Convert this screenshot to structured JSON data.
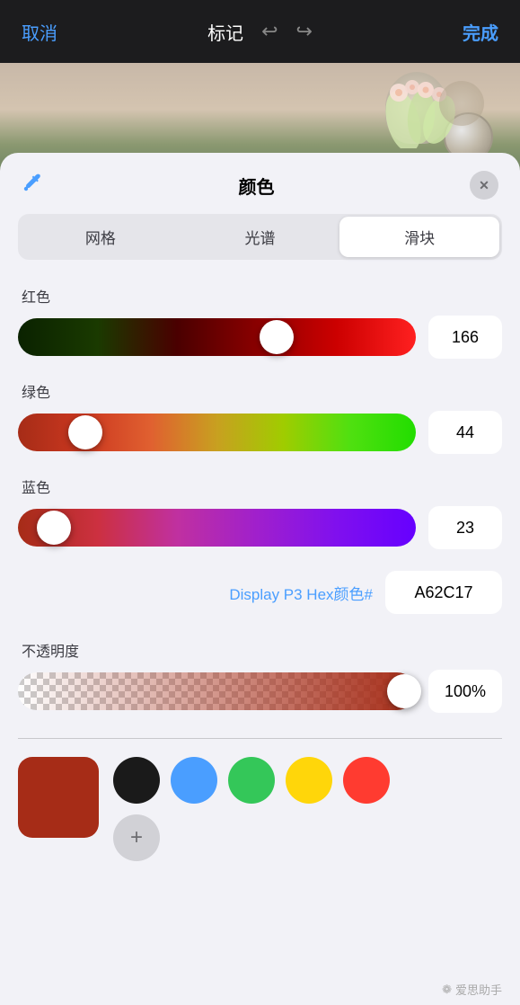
{
  "topBar": {
    "cancel": "取消",
    "title": "标记",
    "done": "完成"
  },
  "panel": {
    "title": "颜色",
    "tabs": [
      {
        "label": "网格",
        "active": false
      },
      {
        "label": "光谱",
        "active": false
      },
      {
        "label": "滑块",
        "active": true
      }
    ],
    "sections": {
      "red": {
        "label": "红色",
        "value": "166",
        "thumbPercent": 65
      },
      "green": {
        "label": "绿色",
        "value": "44",
        "thumbPercent": 17
      },
      "blue": {
        "label": "蓝色",
        "value": "23",
        "thumbPercent": 9
      },
      "hex": {
        "label": "Display P3 Hex颜色#",
        "value": "A62C17"
      },
      "opacity": {
        "label": "不透明度",
        "value": "100%",
        "thumbPercent": 97
      }
    },
    "swatches": {
      "main": "#a62c17",
      "colors": [
        "black",
        "blue",
        "green",
        "yellow",
        "red"
      ],
      "addLabel": "+"
    }
  },
  "watermark": "爱思助手"
}
